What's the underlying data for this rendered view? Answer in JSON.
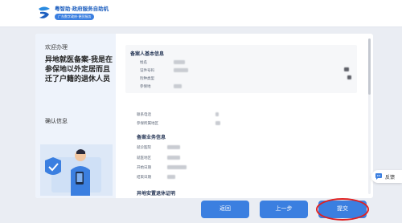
{
  "header": {
    "logo_title": "粤智助·政府服务自助机",
    "logo_subtitle": "广东数字政府·便民服务"
  },
  "left_panel": {
    "welcome": "欢迎办理",
    "title": "异地就医备案-我是在参保地以外定居而且迁了户籍的退休人员",
    "step": "确认信息"
  },
  "form": {
    "section1_title": "备案人基本信息",
    "section1_fields": [
      "姓名",
      "证件号码",
      "险种类型",
      "参保地"
    ],
    "extra_fields": [
      "联系电话",
      "参保所属地区"
    ],
    "section2_title": "备案业务信息",
    "section2_fields": [
      "就诊医院",
      "就医地区",
      "开始日期",
      "结束日期"
    ],
    "section3_title": "异地安置退休证明"
  },
  "buttons": {
    "back": "返回",
    "prev": "上一步",
    "submit": "提交"
  },
  "feedback": {
    "label": "反馈"
  },
  "colors": {
    "primary": "#3b7fe0",
    "highlight": "#e02020",
    "background": "#eaedf3"
  }
}
